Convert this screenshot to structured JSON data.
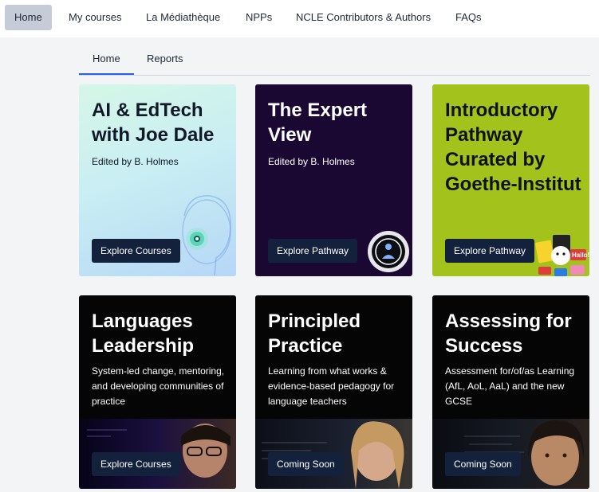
{
  "topnav": {
    "items": [
      {
        "label": "Home",
        "active": true
      },
      {
        "label": "My courses"
      },
      {
        "label": "La Médiathèque"
      },
      {
        "label": "NPPs"
      },
      {
        "label": "NCLE Contributors & Authors"
      },
      {
        "label": "FAQs"
      }
    ]
  },
  "subnav": {
    "tabs": [
      {
        "label": "Home",
        "active": true
      },
      {
        "label": "Reports"
      }
    ]
  },
  "cards": [
    {
      "title": "AI & EdTech with Joe Dale",
      "subtitle": "Edited by B. Holmes",
      "button": "Explore Courses",
      "background": "#d8f5ee",
      "text_color": "#111827"
    },
    {
      "title": "The Expert View",
      "subtitle": "Edited by B. Holmes",
      "button": "Explore Pathway",
      "background": "#1a0833",
      "text_color": "#ffffff"
    },
    {
      "title": "Introductory Pathway Curated by Goethe-Institut",
      "subtitle": "",
      "button": "Explore Pathway",
      "background": "#a3c21c",
      "text_color": "#111111",
      "art_text": "Hallo!"
    },
    {
      "title": "Languages Leadership",
      "subtitle": "System-led change, mentoring, and developing communities of practice",
      "button": "Explore Courses",
      "background": "#050505",
      "text_color": "#ffffff"
    },
    {
      "title": "Principled Practice",
      "subtitle": "Learning from what works & evidence-based pedagogy for language teachers",
      "button": "Coming Soon",
      "background": "#050505",
      "text_color": "#ffffff"
    },
    {
      "title": "Assessing for Success",
      "subtitle": "Assessment for/of/as Learning (AfL, AoL, AaL) and the new GCSE",
      "button": "Coming Soon",
      "background": "#050505",
      "text_color": "#ffffff"
    }
  ]
}
